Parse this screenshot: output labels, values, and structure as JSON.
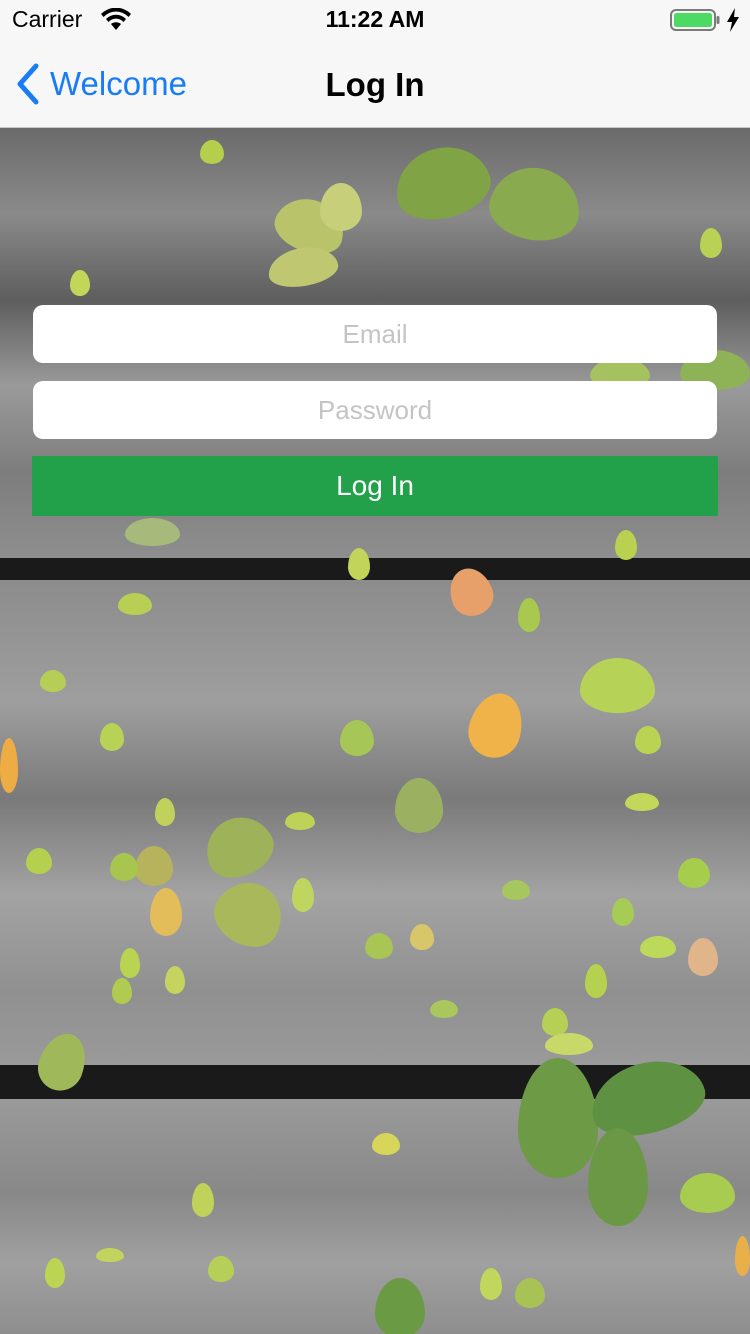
{
  "status_bar": {
    "carrier": "Carrier",
    "time": "11:22 AM",
    "battery_color": "#4cd964"
  },
  "nav": {
    "back_label": "Welcome",
    "title": "Log In",
    "accent_color": "#1a7cf5"
  },
  "form": {
    "email": {
      "value": "",
      "placeholder": "Email"
    },
    "password": {
      "value": "",
      "placeholder": "Password"
    },
    "submit_label": "Log In",
    "submit_color": "#23a14a"
  },
  "background": {
    "description_icon": "wood-planks-with-leaves-image"
  }
}
